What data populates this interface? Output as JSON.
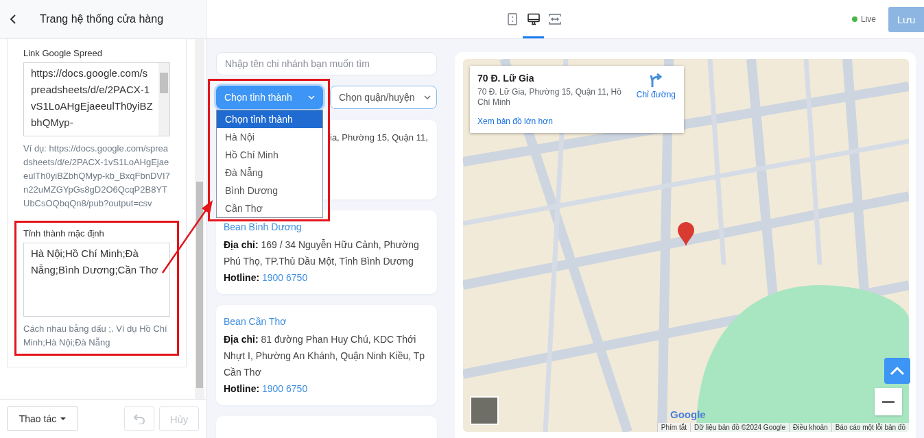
{
  "sidebar": {
    "title": "Trang hệ thống cửa hàng",
    "fields": [
      {
        "kind": "scroll",
        "label": "Link Google Spreed",
        "value": "https://docs.google.com/spreadsheets/d/e/2PACX-1vS1LoAHgEjaeeulTh0yiBZbhQMyp-",
        "help": "Ví dụ: https://docs.google.com/spreadsheets/d/e/2PACX-1vS1LoAHgEjaeeulTh0yiBZbhQMyp-kb_BxqFbnDVI7n22uMZGYpGs8gD2O6QcqP2B8YTUbCsOQbqQn8/pub?output=csv",
        "highlighted": false
      },
      {
        "kind": "plain",
        "label": "Tỉnh thành mặc định",
        "value": "Hà Nội;Hồ Chí Minh;Đà Nẵng;Bình Dương;Cần Thơ",
        "help": "Cách nhau bằng dấu ;. Ví dụ Hồ Chí Minh;Hà Nội;Đà Nẵng",
        "highlighted": true
      }
    ],
    "actions_button": "Thao tác",
    "undo_disabled": true,
    "cancel_button": {
      "label": "Hủy",
      "disabled": true
    }
  },
  "toolbar": {
    "devices": [
      {
        "kind": "mobile",
        "selected": false
      },
      {
        "kind": "desktop",
        "selected": true
      },
      {
        "kind": "fullwidth",
        "selected": false
      }
    ],
    "status": "Live",
    "save_button": {
      "label": "Lưu",
      "disabled": true
    }
  },
  "finder": {
    "search": {
      "placeholder": "Nhập tên chi nhánh bạn muốn tìm"
    },
    "province_select": {
      "label": "Chọn tỉnh thành",
      "expanded": true,
      "highlighted": true,
      "options": [
        {
          "label": "Chọn tỉnh thành",
          "selected": true
        },
        {
          "label": "Hà Nội",
          "selected": false
        },
        {
          "label": "Hồ Chí Minh",
          "selected": false
        },
        {
          "label": "Đà Nẵng",
          "selected": false
        },
        {
          "label": "Bình Dương",
          "selected": false
        },
        {
          "label": "Cần Thơ",
          "selected": false
        }
      ]
    },
    "district_select": {
      "label": "Chọn quận/huyện"
    },
    "stores": [
      {
        "kind": "covered",
        "address": "ia, Phường 15, Quận 11,"
      },
      {
        "kind": "full",
        "name": "Bean Bình Dương",
        "address_label": "Địa chỉ:",
        "address": "169 / 34 Nguyễn Hữu Cảnh, Phường Phú Thọ, TP.Thủ Dầu Một, Tỉnh Bình Dương",
        "hotline_label": "Hotline:",
        "hotline": "1900 6750"
      },
      {
        "kind": "full",
        "name": "Bean Cần Thơ",
        "address_label": "Địa chỉ:",
        "address": "81 đường Phan Huy Chú, KDC Thới Nhựt I, Phường An Khánh, Quận Ninh Kiều, Tp Cần Thơ",
        "hotline_label": "Hotline:",
        "hotline": "1900 6750"
      },
      {
        "kind": "empty"
      }
    ]
  },
  "map": {
    "place": {
      "title": "70 Đ. Lữ Gia",
      "address": "70 Đ. Lữ Gia, Phường 15, Quận 11, Hồ Chí Minh",
      "directions": "Chỉ đường",
      "larger_map_link": "Xem bản đồ lớn hơn"
    },
    "logo": "Google",
    "attribution": [
      "Phím tắt",
      "Dữ liệu bản đồ ©2024 Google",
      "Điều khoản",
      "Báo cáo một lỗi bản đồ"
    ]
  }
}
